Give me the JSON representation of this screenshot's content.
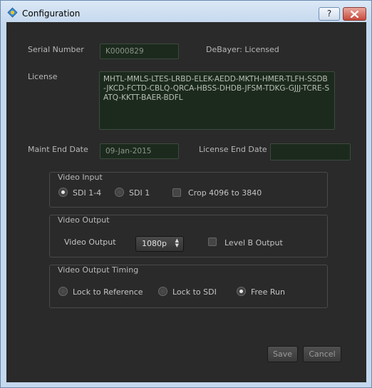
{
  "window": {
    "title": "Configuration",
    "help_label": "?"
  },
  "serial": {
    "label": "Serial Number",
    "value": "K0000829"
  },
  "debayer": {
    "label": "DeBayer: Licensed"
  },
  "license": {
    "label": "License",
    "value": "MHTL-MMLS-LTES-LRBD-ELEK-AEDD-MKTH-HMER-TLFH-SSDB-JKCD-FCTD-CBLQ-QRCA-HBSS-DHDB-JFSM-TDKG-GJJJ-TCRE-SATQ-KKTT-BAER-BDFL"
  },
  "maint_end": {
    "label": "Maint End Date",
    "value": "09-Jan-2015"
  },
  "license_end": {
    "label": "License End Date",
    "value": ""
  },
  "video_input": {
    "title": "Video Input",
    "options": [
      "SDI 1-4",
      "SDI 1"
    ],
    "selected": "SDI 1-4",
    "crop_label": "Crop 4096 to 3840",
    "crop_checked": false
  },
  "video_output": {
    "title": "Video Output",
    "field_label": "Video Output",
    "selected": "1080p",
    "level_b_label": "Level B Output",
    "level_b_checked": false
  },
  "timing": {
    "title": "Video Output Timing",
    "options": [
      "Lock to Reference",
      "Lock to SDI",
      "Free Run"
    ],
    "selected": "Free Run"
  },
  "buttons": {
    "save": "Save",
    "cancel": "Cancel"
  },
  "colors": {
    "background": "#2a2a2a",
    "field_bg": "#1c2a1e",
    "text": "#b8b8b8"
  }
}
